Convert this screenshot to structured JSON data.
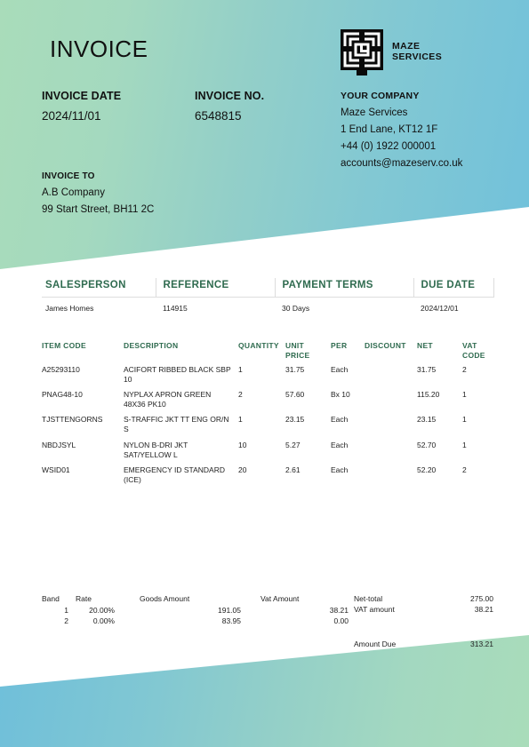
{
  "document": {
    "title": "INVOICE"
  },
  "brand": {
    "logo_icon": "maze-logo-icon",
    "name_line1": "MAZE",
    "name_line2": "SERVICES",
    "accent_green": "#2f6b4f",
    "gradient_start": "#a9dcba",
    "gradient_end": "#71c1db"
  },
  "meta": {
    "date_label": "INVOICE DATE",
    "date_value": "2024/11/01",
    "number_label": "INVOICE NO.",
    "number_value": "6548815"
  },
  "company": {
    "heading": "YOUR COMPANY",
    "name": "Maze Services",
    "address": "1 End Lane, KT12 1F",
    "phone": "+44 (0) 1922 000001",
    "email": "accounts@mazeserv.co.uk"
  },
  "bill_to": {
    "heading": "INVOICE TO",
    "name": "A.B Company",
    "address": "99 Start Street, BH11 2C"
  },
  "sales_info": {
    "headers": [
      "SALESPERSON",
      "REFERENCE",
      "PAYMENT TERMS",
      "DUE DATE"
    ],
    "values": [
      "James Homes",
      "114915",
      "30 Days",
      "2024/12/01"
    ]
  },
  "line_items": {
    "headers": [
      "ITEM CODE",
      "DESCRIPTION",
      "QUANTITY",
      "UNIT PRICE",
      "PER",
      "DISCOUNT",
      "NET",
      "VAT CODE"
    ],
    "rows": [
      {
        "item_code": "A25293110",
        "description": "ACIFORT RIBBED BLACK SBP 10",
        "quantity": "1",
        "unit_price": "31.75",
        "per": "Each",
        "discount": "",
        "net": "31.75",
        "vat_code": "2"
      },
      {
        "item_code": "PNAG48-10",
        "description": "NYPLAX APRON GREEN 48X36 PK10",
        "quantity": "2",
        "unit_price": "57.60",
        "per": "Bx 10",
        "discount": "",
        "net": "115.20",
        "vat_code": "1"
      },
      {
        "item_code": "TJSTTENGORNS",
        "description": "S-TRAFFIC JKT TT ENG OR/N S",
        "quantity": "1",
        "unit_price": "23.15",
        "per": "Each",
        "discount": "",
        "net": "23.15",
        "vat_code": "1"
      },
      {
        "item_code": "NBDJSYL",
        "description": "NYLON B-DRI JKT SAT/YELLOW L",
        "quantity": "10",
        "unit_price": "5.27",
        "per": "Each",
        "discount": "",
        "net": "52.70",
        "vat_code": "1"
      },
      {
        "item_code": "WSID01",
        "description": "EMERGENCY ID STANDARD (ICE)",
        "quantity": "20",
        "unit_price": "2.61",
        "per": "Each",
        "discount": "",
        "net": "52.20",
        "vat_code": "2"
      }
    ]
  },
  "vat_summary": {
    "headers": [
      "Band",
      "Rate",
      "Goods Amount",
      "Vat Amount"
    ],
    "rows": [
      {
        "band": "1",
        "rate": "20.00%",
        "goods_amount": "191.05",
        "vat_amount": "38.21"
      },
      {
        "band": "2",
        "rate": "0.00%",
        "goods_amount": "83.95",
        "vat_amount": "0.00"
      }
    ]
  },
  "totals": {
    "net_total_label": "Net-total",
    "net_total_value": "275.00",
    "vat_amount_label": "VAT amount",
    "vat_amount_value": "38.21",
    "amount_due_label": "Amount Due",
    "amount_due_value": "313.21"
  }
}
